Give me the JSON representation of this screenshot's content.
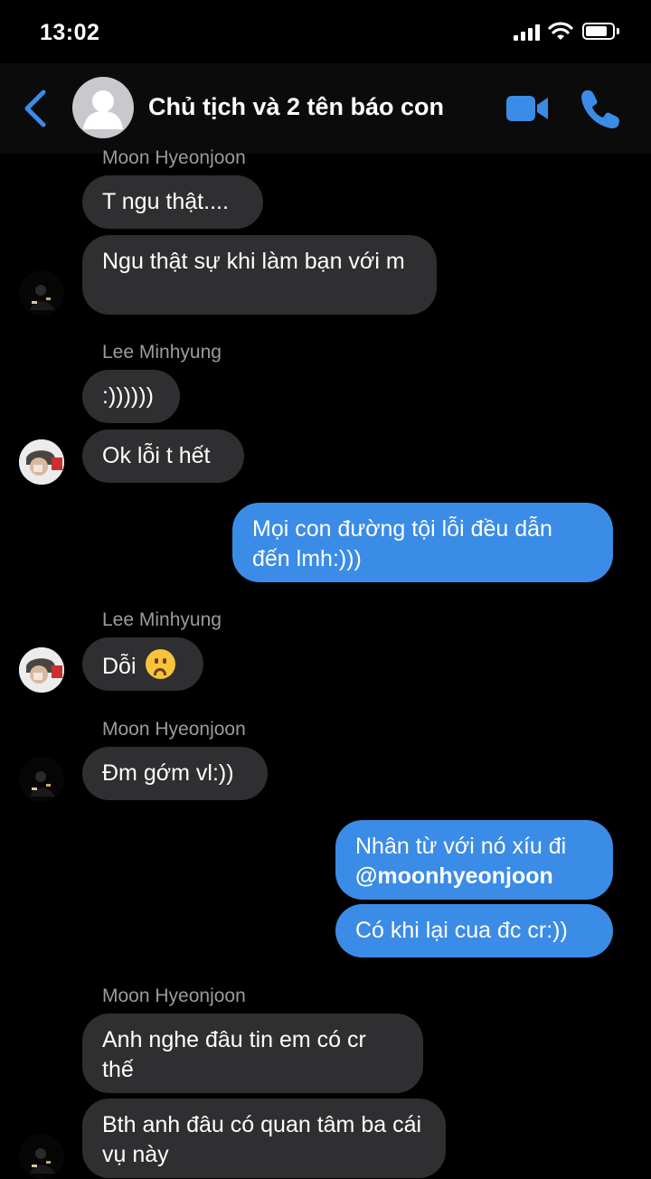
{
  "status_bar": {
    "time": "13:02"
  },
  "header": {
    "title": "Chủ tịch và 2 tên báo con",
    "icons": {
      "back": "chevron-left-icon",
      "video": "video-call-icon",
      "call": "phone-icon",
      "avatar": "group-avatar-icon"
    },
    "accent_color": "#3b8ce6"
  },
  "messages": [
    {
      "sender": "Moon Hyeonjoon"
    },
    {
      "text": "T ngu thật...."
    },
    {
      "text": "Ngu thật sự khi làm bạn với m"
    },
    {
      "sender": "Lee Minhyung"
    },
    {
      "text": ":))))))"
    },
    {
      "text": "Ok lỗi t hết"
    },
    {
      "text": "Mọi con đường tội lỗi đều dẫn đến lmh:)))"
    },
    {
      "sender": "Lee Minhyung"
    },
    {
      "text": "Dỗi",
      "emoji": "frowning-face-emoji"
    },
    {
      "sender": "Moon Hyeonjoon"
    },
    {
      "text": "Đm gớm vl:))"
    },
    {
      "text": "Nhân từ với nó xíu đi",
      "mention": "@moonhyeonjoon"
    },
    {
      "text": "Có khi lại cua đc cr:))"
    },
    {
      "sender": "Moon Hyeonjoon"
    },
    {
      "text": "Anh nghe đâu tin em có cr thế"
    },
    {
      "text": "Bth anh đâu có quan tâm ba cái vụ này"
    }
  ]
}
